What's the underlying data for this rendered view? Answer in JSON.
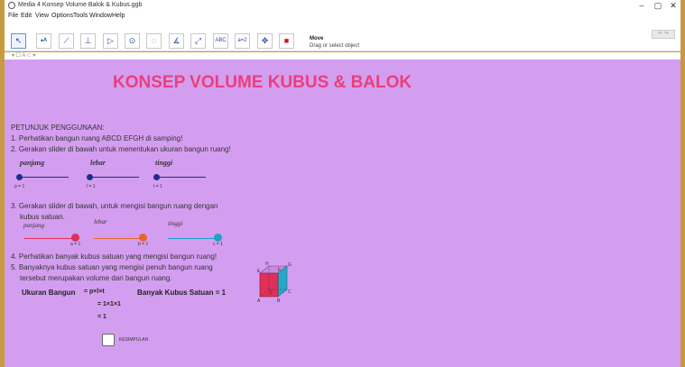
{
  "window": {
    "title": "Media 4 Konsep Volume Balok & Kubus.ggb",
    "minimize": "–",
    "maximize": "▢",
    "close": "✕"
  },
  "menu": [
    "File",
    "Edit",
    "View",
    "Options",
    "Tools",
    "Window",
    "Help"
  ],
  "toolbar": {
    "tools": [
      {
        "name": "move",
        "glyph": "↖"
      },
      {
        "name": "point",
        "glyph": "•ᴬ"
      },
      {
        "name": "line",
        "glyph": "⟋"
      },
      {
        "name": "perpendicular",
        "glyph": "⊥"
      },
      {
        "name": "polygon",
        "glyph": "▷"
      },
      {
        "name": "circle",
        "glyph": "⊙"
      },
      {
        "name": "ellipse",
        "glyph": "◌"
      },
      {
        "name": "angle",
        "glyph": "∡"
      },
      {
        "name": "reflect",
        "glyph": "⤢"
      },
      {
        "name": "text",
        "glyph": "ABC"
      },
      {
        "name": "slider",
        "glyph": "a=2"
      },
      {
        "name": "move-view",
        "glyph": "✥"
      },
      {
        "name": "color",
        "glyph": "■"
      }
    ],
    "help_title": "Move",
    "help_desc": "Drag or select object",
    "undo_redo": "↶ ↷"
  },
  "stylebar": {
    "text": "▾  ☐  A  ⊂ ▾"
  },
  "content": {
    "title": "KONSEP VOLUME KUBUS & BALOK",
    "petunjuk_header": "PETUNJUK PENGGUNAAN:",
    "step1": "1. Perhatikan bangun ruang ABCD EFGH di samping!",
    "step2": "2. Gerakan slider di bawah untuk menentukan ukuran bangun ruang!",
    "step3_line1": "3. Gerakan slider di bawah, untuk mengisi bangun ruang dengan",
    "step3_line2": "kubus satuan.",
    "step4": "4. Perhatikan banyak kubus satuan yang mengisi bangun ruang!",
    "step5_line1": "5. Banyaknya kubus satuan yang mengisi penuh bangun ruang",
    "step5_line2": "tersebut merupakan volume dari bangun ruang.",
    "sliders_row1": [
      {
        "label": "panjang",
        "value_text": "p = 1"
      },
      {
        "label": "lebar",
        "value_text": "l = 1"
      },
      {
        "label": "tinggi",
        "value_text": "t = 1"
      }
    ],
    "sliders_row2": [
      {
        "label": "panjang",
        "value_text": "a = 1",
        "color": "#e0305a"
      },
      {
        "label": "lebar",
        "value_text": "b = 1",
        "color": "#e8662a"
      },
      {
        "label": "tinggi",
        "value_text": "c = 1",
        "color": "#1ca3c8"
      }
    ],
    "ukuran_label": "Ukuran Bangun",
    "formula1": "= p×l×t",
    "formula2": "= 1×1×1",
    "formula3": "= 1",
    "banyak_label": "Banyak Kubus Satuan = 1",
    "checkbox_label": "KESIMPULAN",
    "cube_vertices": [
      "A",
      "B",
      "C",
      "D",
      "E",
      "F",
      "G",
      "H"
    ]
  },
  "colors": {
    "canvas_bg": "#d49ef0",
    "title": "#ec3e7c",
    "slider_row1": "#1c2e8a",
    "cube_front": "#e0305a",
    "cube_top": "#d64f9a",
    "cube_side": "#2aa7c7"
  }
}
